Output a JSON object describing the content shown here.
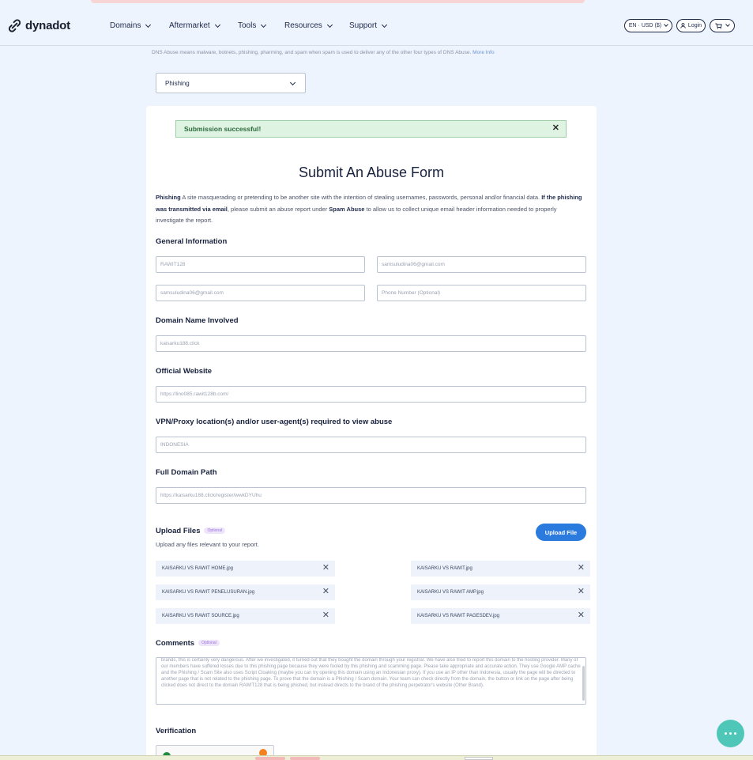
{
  "brand": {
    "name": "dynadot"
  },
  "nav": {
    "items": [
      "Domains",
      "Aftermarket",
      "Tools",
      "Resources",
      "Support"
    ],
    "currency": "EN · USD ($)",
    "login": "Login"
  },
  "note": {
    "text": "DNS Abuse means malware, botnets, phishing, pharming, and spam when spam is used to deliver any of the other four types of DNS Abuse.",
    "link": "More Info"
  },
  "abuse_type": {
    "selected": "Phishing"
  },
  "alert": {
    "message": "Submission successful!"
  },
  "form": {
    "title": "Submit An Abuse Form",
    "description": {
      "term": "Phishing",
      "p1": " A site masquerading or pretending to be another site with the intention of stealing usernames, passwords, personal and/or financial data. ",
      "bold1": "If the phishing was transmitted via email",
      "p2": ", please submit an abuse report under ",
      "bold2": "Spam Abuse",
      "p3": " to allow us to collect unique email header information needed to properly investigate the report."
    },
    "general": {
      "heading": "General Information",
      "name": "RAWIT128",
      "email": "samsuludina06@gmail.com",
      "email_confirm": "samsuludina06@gmail.com",
      "phone_placeholder": "Phone Number (Optional)"
    },
    "domain": {
      "heading": "Domain Name Involved",
      "value": "kaisarku188.click"
    },
    "website": {
      "heading": "Official Website",
      "value": "https://lino085.rawit128b.com/"
    },
    "vpn": {
      "heading": "VPN/Proxy location(s) and/or user-agent(s) required to view abuse",
      "value": "INDONESIA"
    },
    "path": {
      "heading": "Full Domain Path",
      "value": "https://kaisarku188.click/register/wwkDYUhu"
    },
    "upload": {
      "heading": "Upload Files",
      "optional": "Optional",
      "subtitle": "Upload any files relevant to your report.",
      "button": "Upload File",
      "files": [
        "KAISARKU VS RAWIT HOME.jpg",
        "KAISARKU VS RAWIT.jpg",
        "KAISARKU VS RAWIT PENELUSURAN.jpg",
        "KAISARKU VS RAWIT AMP.jpg",
        "KAISARKU VS RAWIT SOURCE.jpg",
        "KAISARKU VS RAWIT PAGESDEV.jpg"
      ]
    },
    "comments": {
      "heading": "Comments",
      "optional": "Optional",
      "value": "brands, this is certainly very dangerous. After we investigated, it turned out that they bought the domain through your registrar. We have also tried to report this domain to the hosting provider. Many of our members have suffered losses due to this phishing page because they were fooled by this phishing and scamming page. Please take appropriate and accurate action. They use Google AMP cache and the Phishing / Scam Site also uses Script Cloaking (maybe you can try opening this domain using an Indonesian proxy). If you use an IP other than Indonesia, usually the page will be directed to another page that is not related to the phishing page. To prove that the domain is a Phishing / Scam domain. Your team can check directly from the domain, the button or link on the page after being clicked does not direct to the domain RAWIT128 that is being phished, but instead directs to the brand of the phishing perpetrator's website (Other Brand)."
    },
    "verification": {
      "heading": "Verification"
    }
  },
  "icons": {
    "logo": "link-logo-icon",
    "chevron": "chevron-down-icon",
    "user": "user-icon",
    "cart": "cart-icon",
    "close": "close-icon",
    "chat": "chat-bubble-icon"
  },
  "colors": {
    "accent": "#2b7bde",
    "success_bg": "#dff3e3",
    "chat": "#4ec7b9"
  }
}
